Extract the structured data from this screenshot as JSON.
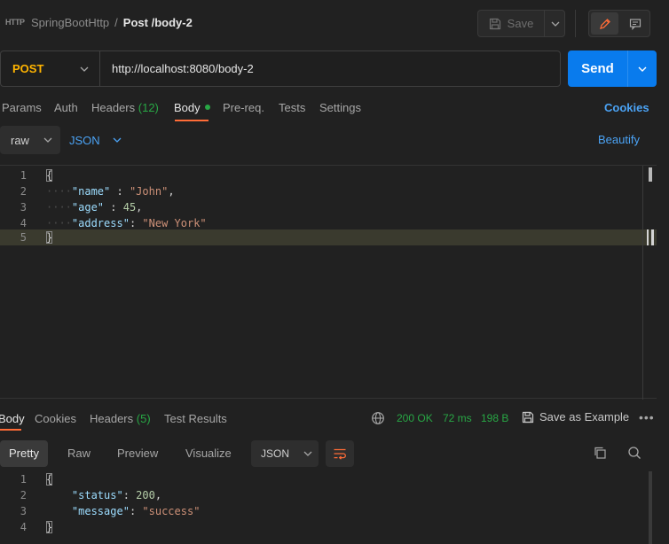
{
  "header": {
    "collection": "SpringBootHttp",
    "separator": "/",
    "request_name": "Post /body-2",
    "save_label": "Save",
    "http_icon_text": "HTTP"
  },
  "request": {
    "method": "POST",
    "url": "http://localhost:8080/body-2",
    "send_label": "Send"
  },
  "request_tabs": {
    "params": "Params",
    "auth": "Auth",
    "headers": "Headers",
    "headers_count": "(12)",
    "body": "Body",
    "prereq": "Pre-req.",
    "tests": "Tests",
    "settings": "Settings",
    "cookies": "Cookies"
  },
  "body_options": {
    "mode": "raw",
    "format": "JSON",
    "beautify": "Beautify"
  },
  "request_body": {
    "lines": [
      {
        "n": "1",
        "brace": "{"
      },
      {
        "n": "2",
        "key": "\"name\"",
        "sep": " : ",
        "str": "\"John\"",
        "end": ","
      },
      {
        "n": "3",
        "key": "\"age\"",
        "sep": " : ",
        "num": "45",
        "end": ","
      },
      {
        "n": "4",
        "key": "\"address\"",
        "sep": ": ",
        "str": "\"New York\"",
        "end": ""
      },
      {
        "n": "5",
        "brace": "}"
      }
    ]
  },
  "response_tabs": {
    "body": "Body",
    "cookies": "Cookies",
    "headers": "Headers",
    "headers_count": "(5)",
    "test_results": "Test Results"
  },
  "response_status": {
    "status": "200 OK",
    "time": "72 ms",
    "size": "198 B",
    "save_example": "Save as Example",
    "more": "•••"
  },
  "response_views": {
    "pretty": "Pretty",
    "raw": "Raw",
    "preview": "Preview",
    "visualize": "Visualize",
    "format": "JSON"
  },
  "response_body": {
    "lines": [
      {
        "n": "1",
        "brace": "{"
      },
      {
        "n": "2",
        "key": "\"status\"",
        "sep": ": ",
        "num": "200",
        "end": ","
      },
      {
        "n": "3",
        "key": "\"message\"",
        "sep": ": ",
        "str": "\"success\"",
        "end": ""
      },
      {
        "n": "4",
        "brace": "}"
      }
    ]
  },
  "colors": {
    "accent": "#097bed",
    "method": "#ffb400",
    "success": "#28a745",
    "tab_underline": "#ff6c37"
  }
}
